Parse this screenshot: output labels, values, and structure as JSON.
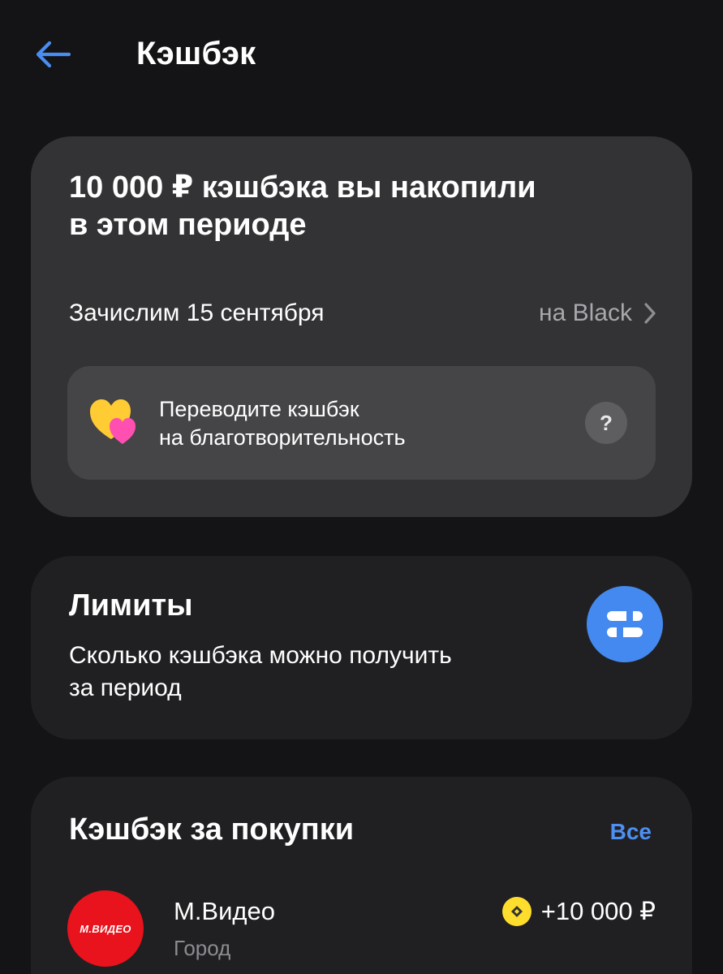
{
  "header": {
    "title": "Кэшбэк"
  },
  "summary": {
    "title_line1": "10 000 ₽ кэшбэка вы накопили",
    "title_line2": "в этом периоде",
    "credit_date": "Зачислим 15 сентября",
    "credit_target": "на Black",
    "charity_line1": "Переводите кэшбэк",
    "charity_line2": "на благотворительность",
    "help_label": "?"
  },
  "limits": {
    "title": "Лимиты",
    "desc_line1": "Сколько кэшбэка можно получить",
    "desc_line2": "за период"
  },
  "purchases": {
    "title": "Кэшбэк за покупки",
    "all_link": "Все",
    "items": [
      {
        "logo_text": "М.ВИДЕО",
        "name": "М.Видео",
        "category": "Город",
        "amount": "+10 000 ₽"
      }
    ]
  },
  "colors": {
    "background": "#141416",
    "summary_card": "#333335",
    "card": "#202022",
    "accent_blue": "#4489f0",
    "link_blue": "#4d8ff2",
    "coin_yellow": "#ffdd2d",
    "store_red": "#e8131c",
    "secondary_text": "#a8a8ad"
  },
  "icons": {
    "back": "arrow-left-icon",
    "chevron": "chevron-right-icon",
    "charity": "hearts-icon",
    "help": "question-icon",
    "limits": "limits-bars-icon",
    "coin": "cashback-coin-icon"
  }
}
